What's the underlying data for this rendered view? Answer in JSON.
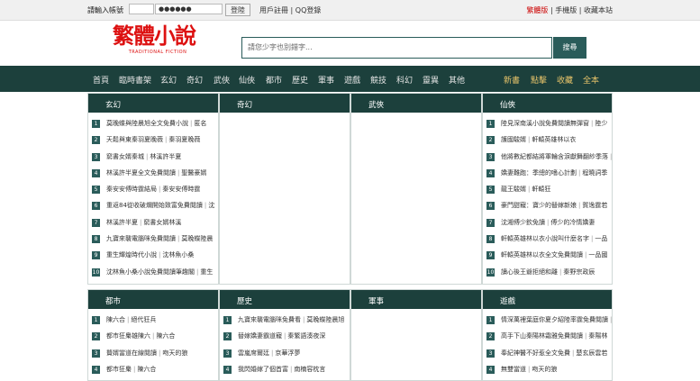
{
  "topbar": {
    "account_label": "請輸入帳號",
    "password_value": "●●●●●●",
    "login_button": "登陸",
    "register_link": "用戶註冊",
    "qq_link": "QQ登錄",
    "traditional_link": "繁體版",
    "mobile_link": "手機版",
    "favorite_link": "收藏本站"
  },
  "logo": {
    "main": "繁體小說",
    "sub": "TRADITIONAL FICTION"
  },
  "search": {
    "placeholder": "請您少字也別錯字...",
    "button": "搜尋"
  },
  "nav": {
    "left": [
      "首頁",
      "臨時書架",
      "玄幻",
      "奇幻",
      "武俠",
      "仙俠",
      "都市",
      "歷史",
      "軍事",
      "遊戲",
      "競技",
      "科幻",
      "靈異",
      "其他"
    ],
    "right": [
      "新書",
      "點擊",
      "收藏",
      "全本"
    ]
  },
  "sections_top": [
    {
      "title": "玄幻",
      "items": [
        [
          "莫晚蝶與陸晨旭全文免費小說",
          "匿名"
        ],
        [
          "天鬆與東秦羽夏晚薇",
          "秦羽夏晚薇"
        ],
        [
          "窮書女婿秦城",
          "林溪許半夏"
        ],
        [
          "林溪許半夏全文免費閱讀",
          "聖醫豪婿"
        ],
        [
          "秦安安傅時霆結局",
          "秦安安傅時霆"
        ],
        [
          "重返84從收破爛開始致富免費閱讀",
          "沈"
        ],
        [
          "林溪許半夏",
          "窮書女婿林溪"
        ],
        [
          "九寶來襲電腦咪免費閱讀",
          "莫晚蝶陸晨"
        ],
        [
          "重生輝煌時代小說",
          "沈林魚小桑"
        ],
        [
          "沈林魚小桑小說免費閱讀筆趣閣",
          "重生"
        ]
      ]
    },
    {
      "title": "奇幻",
      "items": []
    },
    {
      "title": "武俠",
      "items": []
    },
    {
      "title": "仙俠",
      "items": [
        [
          "陸見深南溪小說免費閱讀無彈窗",
          "陸少"
        ],
        [
          "護國駿婿",
          "軒轅英雄林以衣"
        ],
        [
          "他將數紀都結將軍輪含淚獻舞翻紗季落",
          "白"
        ],
        [
          "嬌妻難跑：季總的嗜心計劃",
          "程曉詞季"
        ],
        [
          "龍王駿婿",
          "軒轅狂"
        ],
        [
          "豪門甜寵：寶少的替嫁新娘",
          "賀逸霆若"
        ],
        [
          "沈湘傅少欽免讀",
          "傅少的冷情嬌妻"
        ],
        [
          "軒轅英雄林以衣小說叫什麼名字",
          "一品"
        ],
        [
          "軒轅英雄林以衣全文免費閱讀",
          "一品國"
        ],
        [
          "讀心後王爺拒絕和離",
          "秦野宗政辰"
        ]
      ]
    }
  ],
  "sections_bottom": [
    {
      "title": "都市",
      "items": [
        [
          "陳六合",
          "絕代狂兵"
        ],
        [
          "都市狂梟雄陳六",
          "陳六合"
        ],
        [
          "贅婿當道在線閱讀",
          "吻天的狼"
        ],
        [
          "都市狂梟",
          "陳六合"
        ]
      ]
    },
    {
      "title": "歷史",
      "items": [
        [
          "九寶來襲電腦咪免費看",
          "莫晚蝶陸晨旭"
        ],
        [
          "替嫁嬌妻霸道寵",
          "秦繁語湊夜深"
        ],
        [
          "雲嵐席爾廷",
          "京華浮夢"
        ],
        [
          "我閃婚嫁了個首富",
          "南楠容枕言"
        ]
      ]
    },
    {
      "title": "軍事",
      "items": []
    },
    {
      "title": "遊戲",
      "items": [
        [
          "情深萬裡葉庭你夏夕紹陸率霆免費閱讀",
          "情"
        ],
        [
          "高手下山秦陽林霜雅免費閱讀",
          "秦陽林"
        ],
        [
          "奉紀神醫不好惹全文免費",
          "楚玄辰雲若"
        ],
        [
          "無雙當道",
          "吻天的狼"
        ]
      ]
    }
  ]
}
